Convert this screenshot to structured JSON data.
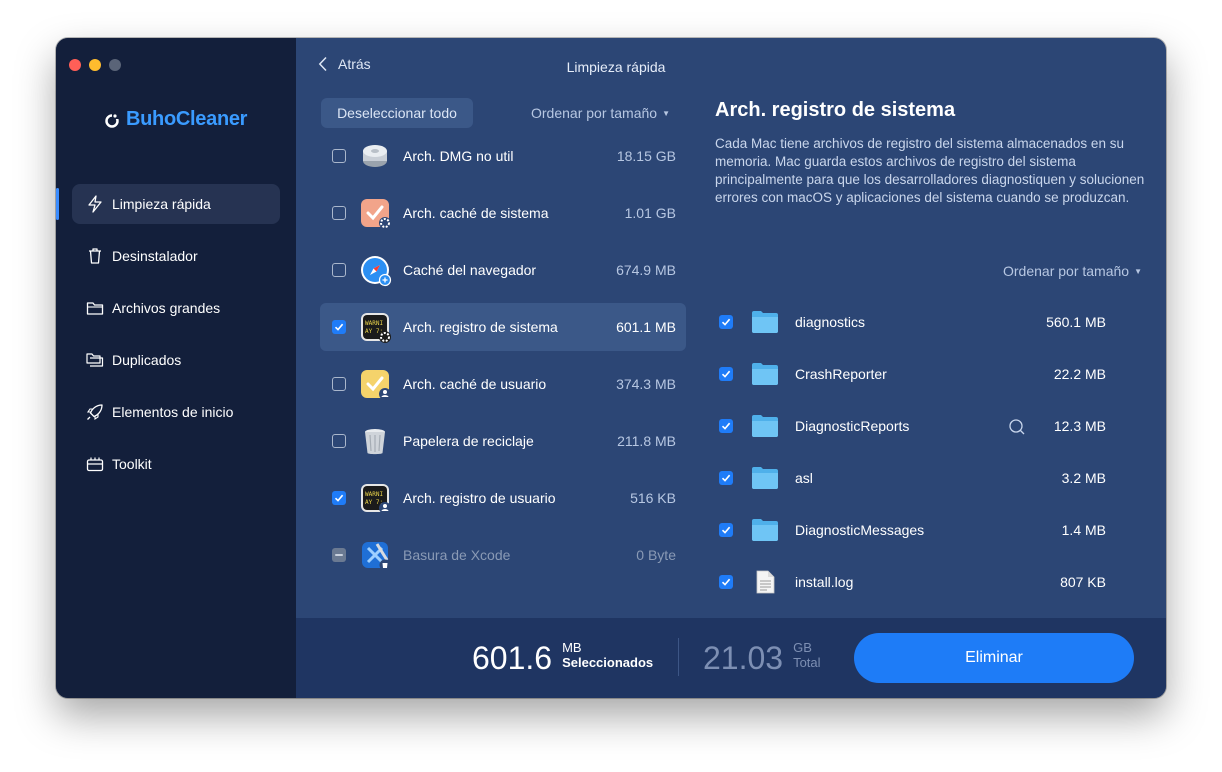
{
  "window": {
    "title": "Limpieza rápida"
  },
  "header": {
    "back_label": "Atrás",
    "title": "Limpieza rápida"
  },
  "sidebar": {
    "brand": "BuhoCleaner",
    "items": [
      {
        "label": "Limpieza rápida",
        "icon": "lightning-icon",
        "active": true
      },
      {
        "label": "Desinstalador",
        "icon": "trash-icon",
        "active": false
      },
      {
        "label": "Archivos grandes",
        "icon": "folder-icon",
        "active": false
      },
      {
        "label": "Duplicados",
        "icon": "duplicate-folder-icon",
        "active": false
      },
      {
        "label": "Elementos de inicio",
        "icon": "rocket-icon",
        "active": false
      },
      {
        "label": "Toolkit",
        "icon": "toolbox-icon",
        "active": false
      }
    ]
  },
  "list": {
    "deselect_label": "Deseleccionar todo",
    "sort_label": "Ordenar por tamaño",
    "items": [
      {
        "label": "Arch. DMG no util",
        "size": "18.15 GB",
        "checked": "off",
        "icon": "disk-icon"
      },
      {
        "label": "Arch. caché de sistema",
        "size": "1.01 GB",
        "checked": "off",
        "icon": "system-cache-icon"
      },
      {
        "label": "Caché del navegador",
        "size": "674.9 MB",
        "checked": "off",
        "icon": "safari-icon"
      },
      {
        "label": "Arch. registro de sistema",
        "size": "601.1 MB",
        "checked": "on",
        "icon": "console-log-icon",
        "selected": true
      },
      {
        "label": "Arch. caché de usuario",
        "size": "374.3 MB",
        "checked": "off",
        "icon": "user-cache-icon"
      },
      {
        "label": "Papelera de reciclaje",
        "size": "211.8 MB",
        "checked": "off",
        "icon": "recycle-bin-icon"
      },
      {
        "label": "Arch. registro de usuario",
        "size": "516 KB",
        "checked": "on",
        "icon": "user-log-icon"
      },
      {
        "label": "Basura de Xcode",
        "size": "0 Byte",
        "checked": "mixed",
        "icon": "xcode-icon",
        "disabled": true
      }
    ]
  },
  "detail": {
    "title": "Arch. registro de sistema",
    "description": "Cada Mac tiene archivos de registro del sistema almacenados en su memoria. Mac guarda estos archivos de registro del sistema principalmente para que los desarrolladores diagnostiquen y solucionen errores con macOS y aplicaciones del sistema cuando se produzcan.",
    "sort_label": "Ordenar por tamaño",
    "files": [
      {
        "name": "diagnostics",
        "size": "560.1 MB",
        "type": "folder"
      },
      {
        "name": "CrashReporter",
        "size": "22.2 MB",
        "type": "folder"
      },
      {
        "name": "DiagnosticReports",
        "size": "12.3 MB",
        "type": "folder",
        "hover": true
      },
      {
        "name": "asl",
        "size": "3.2 MB",
        "type": "folder"
      },
      {
        "name": "DiagnosticMessages",
        "size": "1.4 MB",
        "type": "folder"
      },
      {
        "name": "install.log",
        "size": "807 KB",
        "type": "document"
      }
    ]
  },
  "footer": {
    "selected_value": "601.6",
    "selected_unit": "MB",
    "selected_label": "Seleccionados",
    "total_value": "21.03",
    "total_unit": "GB",
    "total_label": "Total",
    "delete_label": "Eliminar"
  },
  "colors": {
    "sidebar_bg": "#131f3b",
    "main_bg": "#2c4675",
    "footer_bg": "#1f3562",
    "accent": "#1e7cf7",
    "brand": "#3a9bff"
  }
}
